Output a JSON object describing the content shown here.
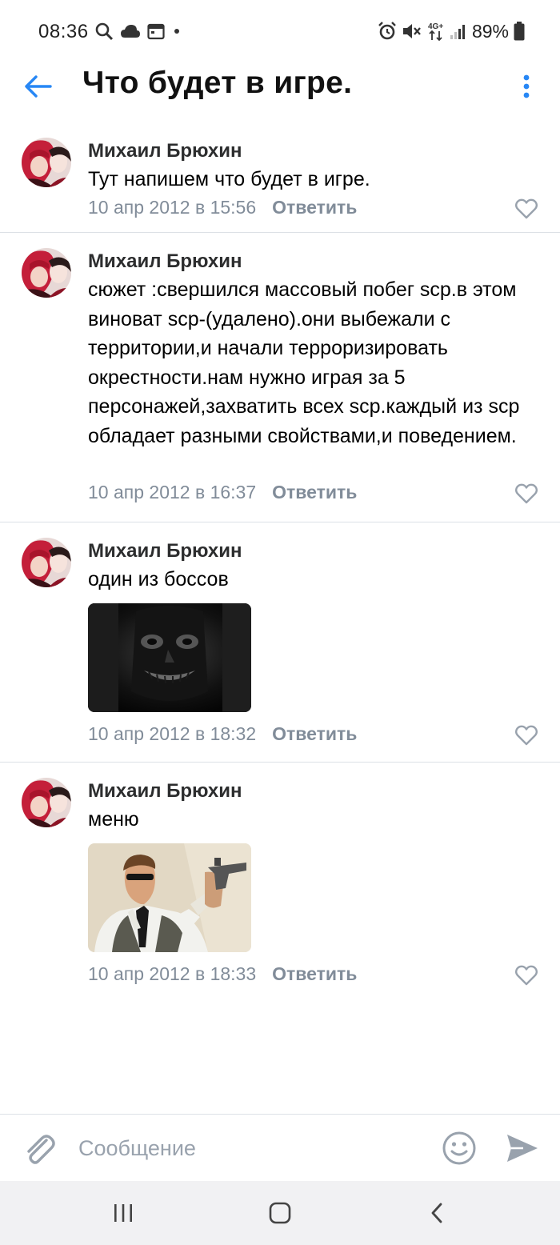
{
  "status_bar": {
    "time": "08:36",
    "battery": "89%",
    "network": "4G+"
  },
  "header": {
    "title": "Что будет в игре."
  },
  "comments": [
    {
      "author": "Михаил Брюхин",
      "text": "Тут напишем что будет в игре.",
      "date": "10 апр 2012 в 15:56",
      "reply": "Ответить",
      "attachment": null
    },
    {
      "author": "Михаил Брюхин",
      "text": "сюжет :свершился массовый побег scp.в этом виноват scp-(удалено).они выбежали с территории,и начали терроризировать окрестности.нам нужно играя за 5 персонажей,захватить всех scp.каждый из scp обладает разными свойствами,и поведением.",
      "date": "10 апр 2012 в 16:37",
      "reply": "Ответить",
      "attachment": null
    },
    {
      "author": "Михаил Брюхин",
      "text": "один из боссов",
      "date": "10 апр 2012 в 18:32",
      "reply": "Ответить",
      "attachment": "dark-face-image"
    },
    {
      "author": "Михаил Брюхин",
      "text": "меню",
      "date": "10 апр 2012 в 18:33",
      "reply": "Ответить",
      "attachment": "agent-with-pistol-image"
    }
  ],
  "composer": {
    "placeholder": "Сообщение"
  },
  "colors": {
    "accent": "#2787f5",
    "meta": "#818c99",
    "divider": "#dce1e6",
    "icon_gray": "#99a2ad"
  },
  "icons": [
    "arrow-left-icon",
    "more-vertical-icon",
    "heart-icon",
    "paperclip-icon",
    "smile-icon",
    "send-icon",
    "recent-apps-icon",
    "home-icon",
    "back-icon"
  ]
}
